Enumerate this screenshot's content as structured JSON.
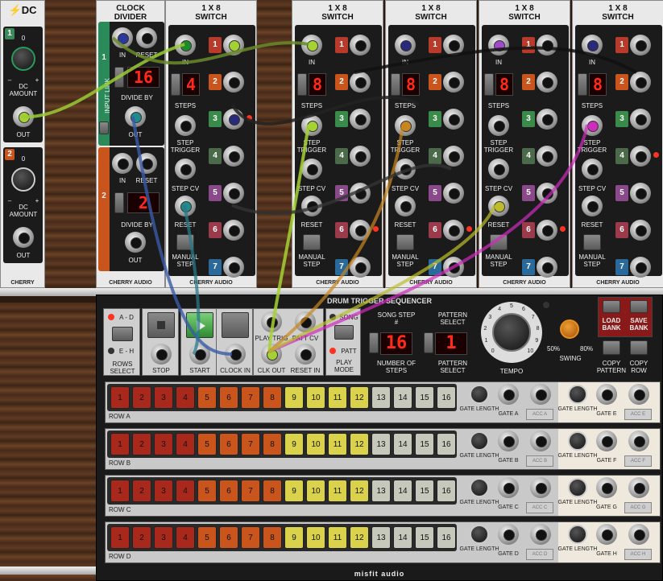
{
  "dc": {
    "title": "DC",
    "ch1": "1",
    "ch2": "2",
    "amount": "DC AMOUNT",
    "minus": "–",
    "plus": "+",
    "zero": "0",
    "out": "OUT",
    "brand": "CHERRY"
  },
  "clock": {
    "title1": "CLOCK",
    "title2": "DIVIDER",
    "in": "IN",
    "reset": "RESET",
    "divide": "DIVIDE BY",
    "out": "OUT",
    "link": "INPUT LINK",
    "ch1": "1",
    "ch2": "2",
    "d1": "16",
    "d2": "2",
    "brand": "CHERRY AUDIO"
  },
  "switch": {
    "title1": "1 X 8",
    "title2": "SWITCH",
    "in": "IN",
    "steps": "STEPS",
    "trigger": "STEP TRIGGER",
    "cv": "STEP CV",
    "reset": "RESET",
    "manual": "MANUAL STEP",
    "brand": "CHERRY AUDIO",
    "nums": [
      "1",
      "2",
      "3",
      "4",
      "5",
      "6",
      "7",
      "8"
    ],
    "displays": [
      "4",
      "8",
      "8",
      "8",
      "8"
    ]
  },
  "seq": {
    "title": "DRUM TRIGGER SEQUENCER",
    "ad": "A - D",
    "eh": "E - H",
    "rows_select": "ROWS SELECT",
    "stop": "STOP",
    "start": "START",
    "clock_in": "CLOCK IN",
    "play_trig": "PLAY TRIG",
    "clk_out": "CLK OUT",
    "patt_cv": "PATT CV",
    "reset_in": "RESET IN",
    "song": "SONG",
    "patt": "PATT",
    "play_mode": "PLAY MODE",
    "song_step": "SONG STEP #",
    "pattern_select": "PATTERN SELECT",
    "number_of_steps": "NUMBER OF STEPS",
    "pattern_select2": "PATTERN SELECT",
    "steps_val": "16",
    "pattern_val": "1",
    "tempo": "TEMPO",
    "swing": "SWING",
    "sw50": "50%",
    "sw80": "80%",
    "load": "LOAD BANK",
    "save": "SAVE BANK",
    "copy_pattern": "COPY PATTERN",
    "copy_row": "COPY ROW",
    "gate_length": "GATE LENGTH",
    "brand": "misfit audio",
    "tempo_ticks": [
      "0",
      "1",
      "2",
      "3",
      "4",
      "5",
      "6",
      "7",
      "8",
      "9",
      "10"
    ],
    "steps": [
      "1",
      "2",
      "3",
      "4",
      "5",
      "6",
      "7",
      "8",
      "9",
      "10",
      "11",
      "12",
      "13",
      "14",
      "15",
      "16"
    ],
    "rows": [
      {
        "label": "ROW A",
        "g1": "GATE A",
        "a1": "ACC A",
        "g2": "GATE E",
        "a2": "ACC E"
      },
      {
        "label": "ROW B",
        "g1": "GATE B",
        "a1": "ACC B",
        "g2": "GATE F",
        "a2": "ACC F"
      },
      {
        "label": "ROW C",
        "g1": "GATE C",
        "a1": "ACC C",
        "g2": "GATE G",
        "a2": "ACC G"
      },
      {
        "label": "ROW D",
        "g1": "GATE D",
        "a1": "ACC D",
        "g2": "GATE H",
        "a2": "ACC H"
      }
    ]
  },
  "colors": {
    "panel": "#e9e9e9",
    "step_red": "#a8281c",
    "step_orange": "#c9541c",
    "step_yellow": "#d9d24a",
    "step_gray": "#c6c8bc",
    "led": "#ff2a1a"
  }
}
